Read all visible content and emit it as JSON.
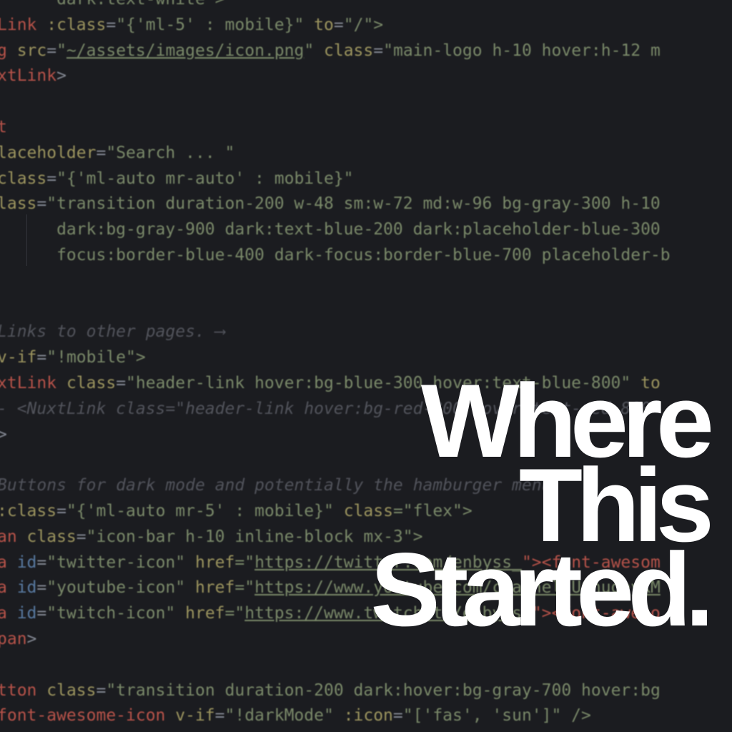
{
  "code_lines": [
    [
      {
        "t": "      dark:text-white\">",
        "k": "str"
      }
    ],
    [
      {
        "t": "Link ",
        "k": "tag"
      },
      {
        "t": ":class",
        "k": "attr"
      },
      {
        "t": "=",
        "k": "punct"
      },
      {
        "t": "\"{'ml-5' : mobile}\"",
        "k": "str"
      },
      {
        "t": " to",
        "k": "attr"
      },
      {
        "t": "=",
        "k": "punct"
      },
      {
        "t": "\"/\">",
        "k": "str"
      }
    ],
    [
      {
        "t": "g ",
        "k": "tag"
      },
      {
        "t": "src",
        "k": "attr"
      },
      {
        "t": "=",
        "k": "punct"
      },
      {
        "t": "\"",
        "k": "str"
      },
      {
        "t": "~/assets/images/icon.png",
        "k": "url"
      },
      {
        "t": "\" ",
        "k": "str"
      },
      {
        "t": "class",
        "k": "attr"
      },
      {
        "t": "=",
        "k": "punct"
      },
      {
        "t": "\"main-logo h-10 hover:h-12 m",
        "k": "str"
      }
    ],
    [
      {
        "t": "xtLink",
        "k": "tag"
      },
      {
        "t": ">",
        "k": "punct"
      }
    ],
    [
      {
        "t": "",
        "k": "plain"
      }
    ],
    [
      {
        "t": "t",
        "k": "tag"
      }
    ],
    [
      {
        "t": "laceholder",
        "k": "attr"
      },
      {
        "t": "=",
        "k": "punct"
      },
      {
        "t": "\"Search ... \"",
        "k": "str"
      }
    ],
    [
      {
        "t": "class",
        "k": "attr"
      },
      {
        "t": "=",
        "k": "punct"
      },
      {
        "t": "\"{'ml-auto mr-auto' : mobile}\"",
        "k": "str"
      }
    ],
    [
      {
        "t": "lass",
        "k": "attr"
      },
      {
        "t": "=",
        "k": "punct"
      },
      {
        "t": "\"transition duration-200 w-48 sm:w-72 md:w-96 bg-gray-300 h-10",
        "k": "str"
      }
    ],
    [
      {
        "t": "      dark:bg-gray-900 dark:text-blue-200 dark:placeholder-blue-300",
        "k": "str"
      }
    ],
    [
      {
        "t": "      focus:border-blue-400 dark-focus:border-blue-700 placeholder-b",
        "k": "str"
      }
    ],
    [
      {
        "t": "",
        "k": "plain"
      }
    ],
    [
      {
        "t": "",
        "k": "plain"
      }
    ],
    [
      {
        "t": "Links to other pages. ⟶",
        "k": "comment"
      }
    ],
    [
      {
        "t": "v-if",
        "k": "attr"
      },
      {
        "t": "=",
        "k": "punct"
      },
      {
        "t": "\"!mobile\">",
        "k": "str"
      }
    ],
    [
      {
        "t": "xtLink ",
        "k": "tag"
      },
      {
        "t": "class",
        "k": "attr"
      },
      {
        "t": "=",
        "k": "punct"
      },
      {
        "t": "\"header-link hover:bg-blue-300 hover:text-blue-800\"",
        "k": "str"
      },
      {
        "t": " to",
        "k": "attr"
      }
    ],
    [
      {
        "t": "- <NuxtLink class=\"header-link hover:bg-red-300 hover:text-red-800",
        "k": "comment"
      }
    ],
    [
      {
        "t": ">",
        "k": "punct"
      }
    ],
    [
      {
        "t": "",
        "k": "plain"
      }
    ],
    [
      {
        "t": "Buttons for dark mode and potentially the hamburger menu.",
        "k": "comment"
      }
    ],
    [
      {
        "t": ":class",
        "k": "attr"
      },
      {
        "t": "=",
        "k": "punct"
      },
      {
        "t": "\"{'ml-auto mr-5' : mobile}\" ",
        "k": "str"
      },
      {
        "t": "class",
        "k": "attr"
      },
      {
        "t": "=\"flex\">",
        "k": "str"
      }
    ],
    [
      {
        "t": "an ",
        "k": "tag"
      },
      {
        "t": "class",
        "k": "attr"
      },
      {
        "t": "=",
        "k": "punct"
      },
      {
        "t": "\"icon-bar h-10 inline-block mx-3\">",
        "k": "str"
      }
    ],
    [
      {
        "t": "a ",
        "k": "tag"
      },
      {
        "t": "id",
        "k": "id"
      },
      {
        "t": "=",
        "k": "punct"
      },
      {
        "t": "\"twitter-icon\" ",
        "k": "str"
      },
      {
        "t": "href",
        "k": "attr"
      },
      {
        "t": "=\"",
        "k": "str"
      },
      {
        "t": "https://twitter.com/enbyss_",
        "k": "url"
      },
      {
        "t": "\"><font-awesom",
        "k": "tag"
      }
    ],
    [
      {
        "t": "a ",
        "k": "tag"
      },
      {
        "t": "id",
        "k": "id"
      },
      {
        "t": "=",
        "k": "punct"
      },
      {
        "t": "\"youtube-icon\" ",
        "k": "str"
      },
      {
        "t": "href",
        "k": "attr"
      },
      {
        "t": "=\"",
        "k": "str"
      },
      {
        "t": "https://www.youtube.com/channel/UCnugeyKM",
        "k": "url"
      }
    ],
    [
      {
        "t": "a ",
        "k": "tag"
      },
      {
        "t": "id",
        "k": "id"
      },
      {
        "t": "=",
        "k": "punct"
      },
      {
        "t": "\"twitch-icon\" ",
        "k": "str"
      },
      {
        "t": "href",
        "k": "attr"
      },
      {
        "t": "=\"",
        "k": "str"
      },
      {
        "t": "https://www.twitch.tv/enbyss_",
        "k": "url"
      },
      {
        "t": "\"><font-aweso",
        "k": "tag"
      }
    ],
    [
      {
        "t": "pan",
        "k": "tag"
      },
      {
        "t": ">",
        "k": "punct"
      }
    ],
    [
      {
        "t": "",
        "k": "plain"
      }
    ],
    [
      {
        "t": "tton ",
        "k": "tag"
      },
      {
        "t": "class",
        "k": "attr"
      },
      {
        "t": "=",
        "k": "punct"
      },
      {
        "t": "\"transition duration-200 dark:hover:bg-gray-700 hover:bg",
        "k": "str"
      }
    ],
    [
      {
        "t": "font-awesome-icon ",
        "k": "tag"
      },
      {
        "t": "v-if",
        "k": "attr"
      },
      {
        "t": "=",
        "k": "punct"
      },
      {
        "t": "\"!darkMode\" ",
        "k": "str"
      },
      {
        "t": ":icon",
        "k": "attr"
      },
      {
        "t": "=",
        "k": "punct"
      },
      {
        "t": "\"['fas', 'sun']\" />",
        "k": "str"
      }
    ]
  ],
  "title": {
    "line1": "Where",
    "line2": "This",
    "line3": "Started."
  }
}
